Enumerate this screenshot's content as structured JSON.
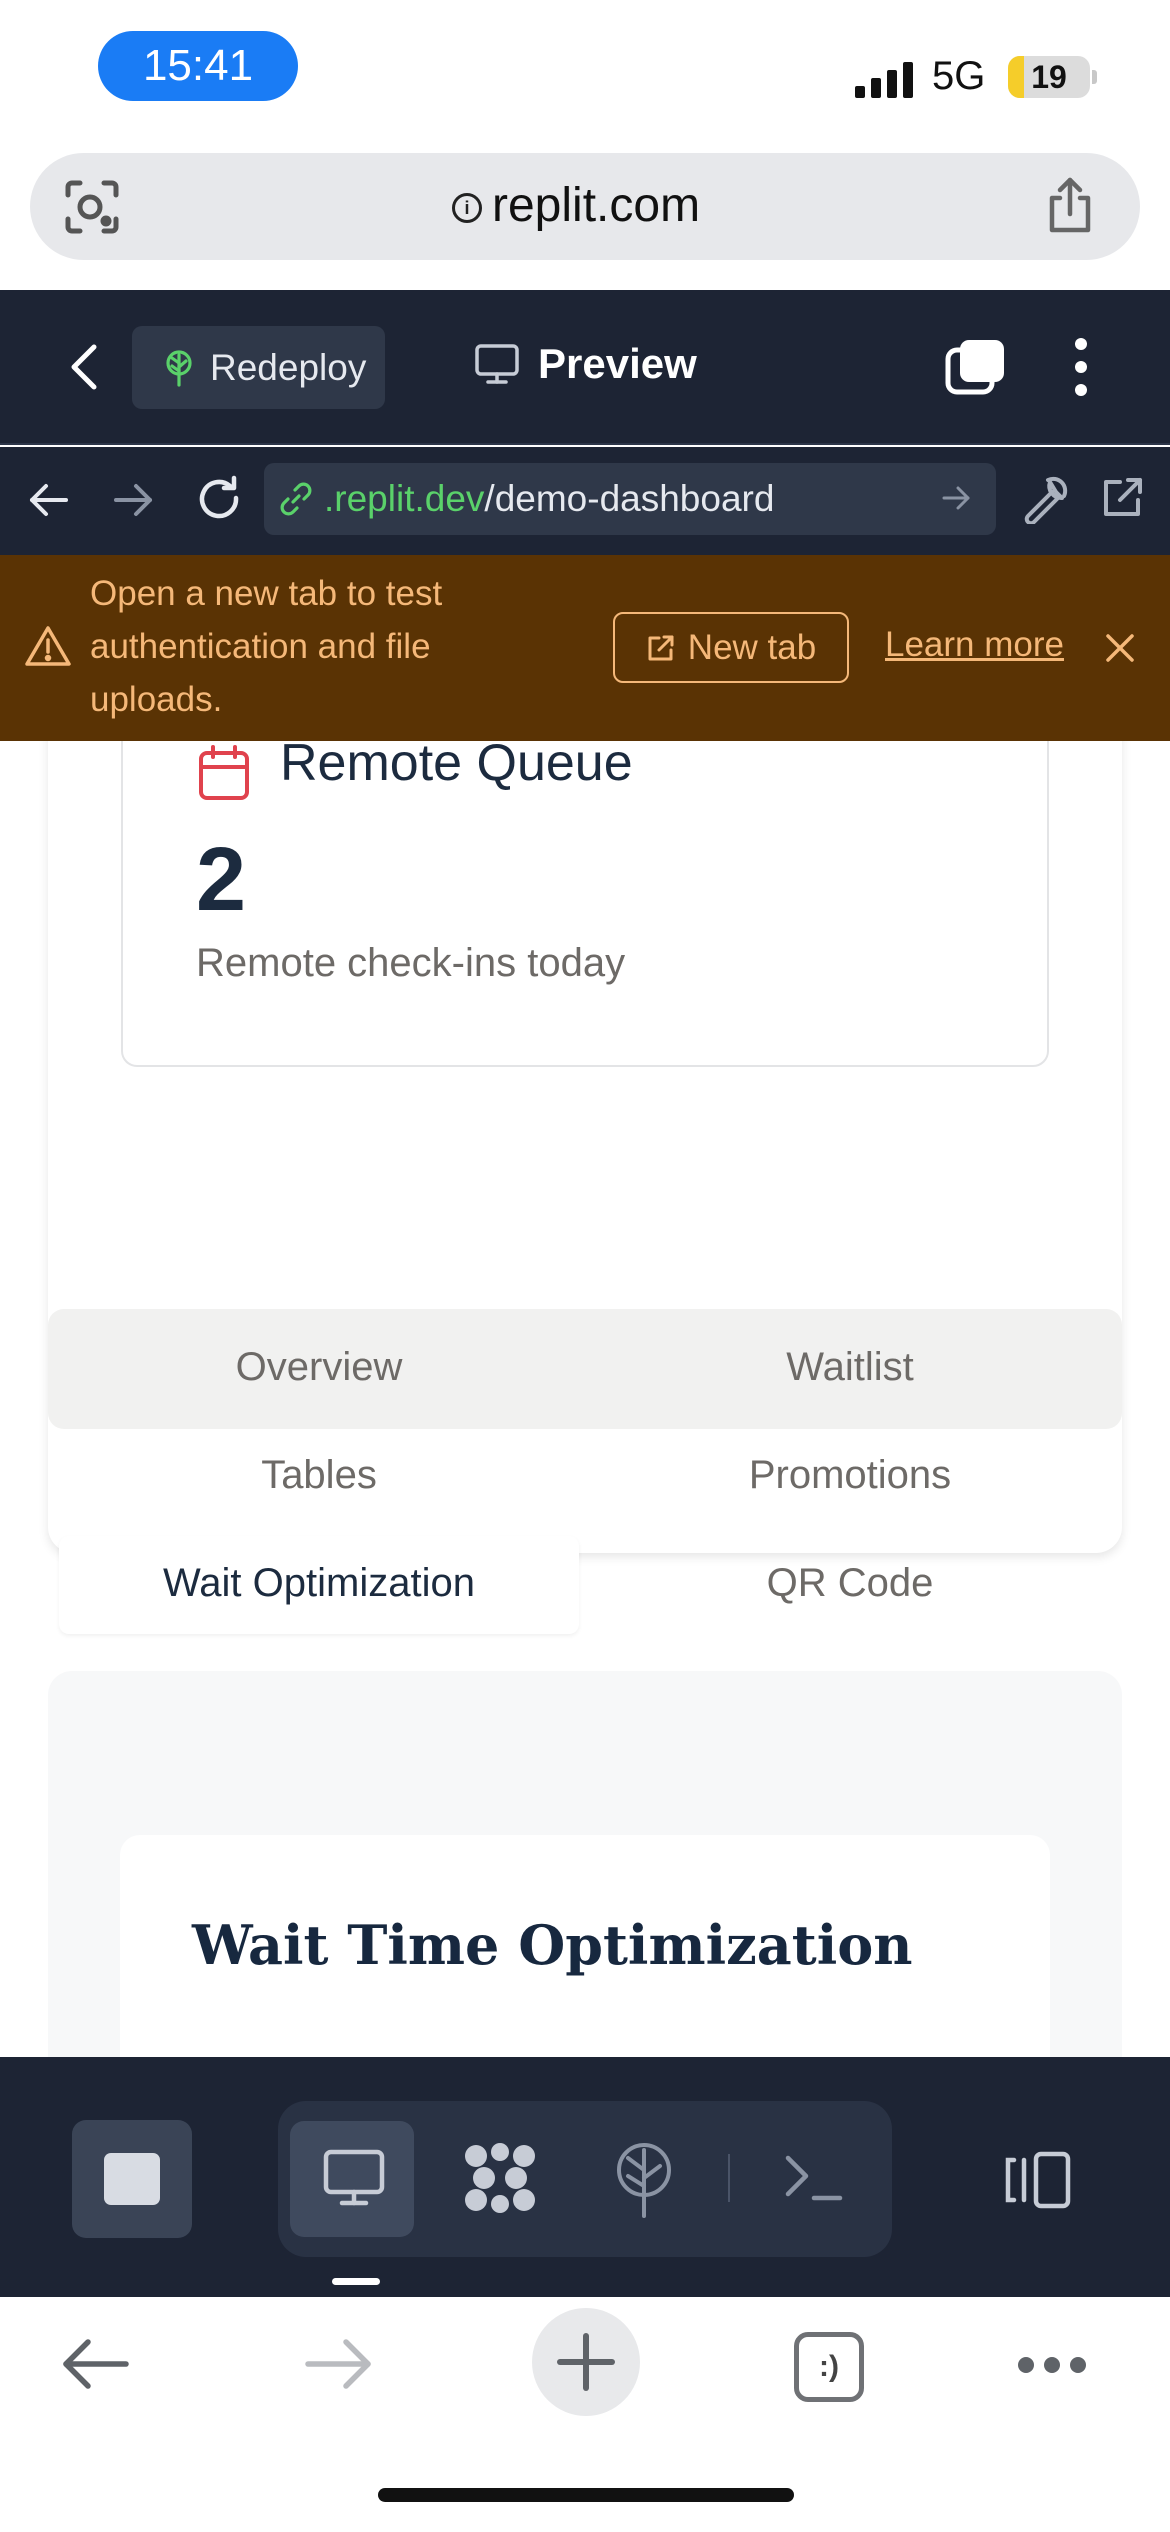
{
  "status_bar": {
    "time": "15:41",
    "network": "5G",
    "battery": "19",
    "battery_level_percent": 19
  },
  "browser": {
    "url": "replit.com"
  },
  "replit_header": {
    "redeploy_label": "Redeploy",
    "preview_label": "Preview"
  },
  "nav": {
    "url_domain": ".replit.dev",
    "url_path": "/demo-dashboard"
  },
  "banner": {
    "message": "Open a new tab to test authentication and file uploads.",
    "new_tab_label": "New tab",
    "learn_more_label": "Learn more"
  },
  "remote_card": {
    "title": "Remote Queue",
    "count": "2",
    "subtitle": "Remote check-ins today"
  },
  "tabs": [
    {
      "label": "Overview"
    },
    {
      "label": "Waitlist"
    },
    {
      "label": "Tables"
    },
    {
      "label": "Promotions"
    },
    {
      "label": "Wait Optimization",
      "active": true
    },
    {
      "label": "QR Code"
    }
  ],
  "panel": {
    "title": "Wait Time Optimization"
  },
  "colors": {
    "dark_navy": "#1d2434",
    "banner_bg": "#5a3304",
    "banner_text": "#f5b879",
    "link_green": "#5ad16a",
    "alert_red": "#e0424d"
  },
  "tab_switcher_glyph": ":)"
}
